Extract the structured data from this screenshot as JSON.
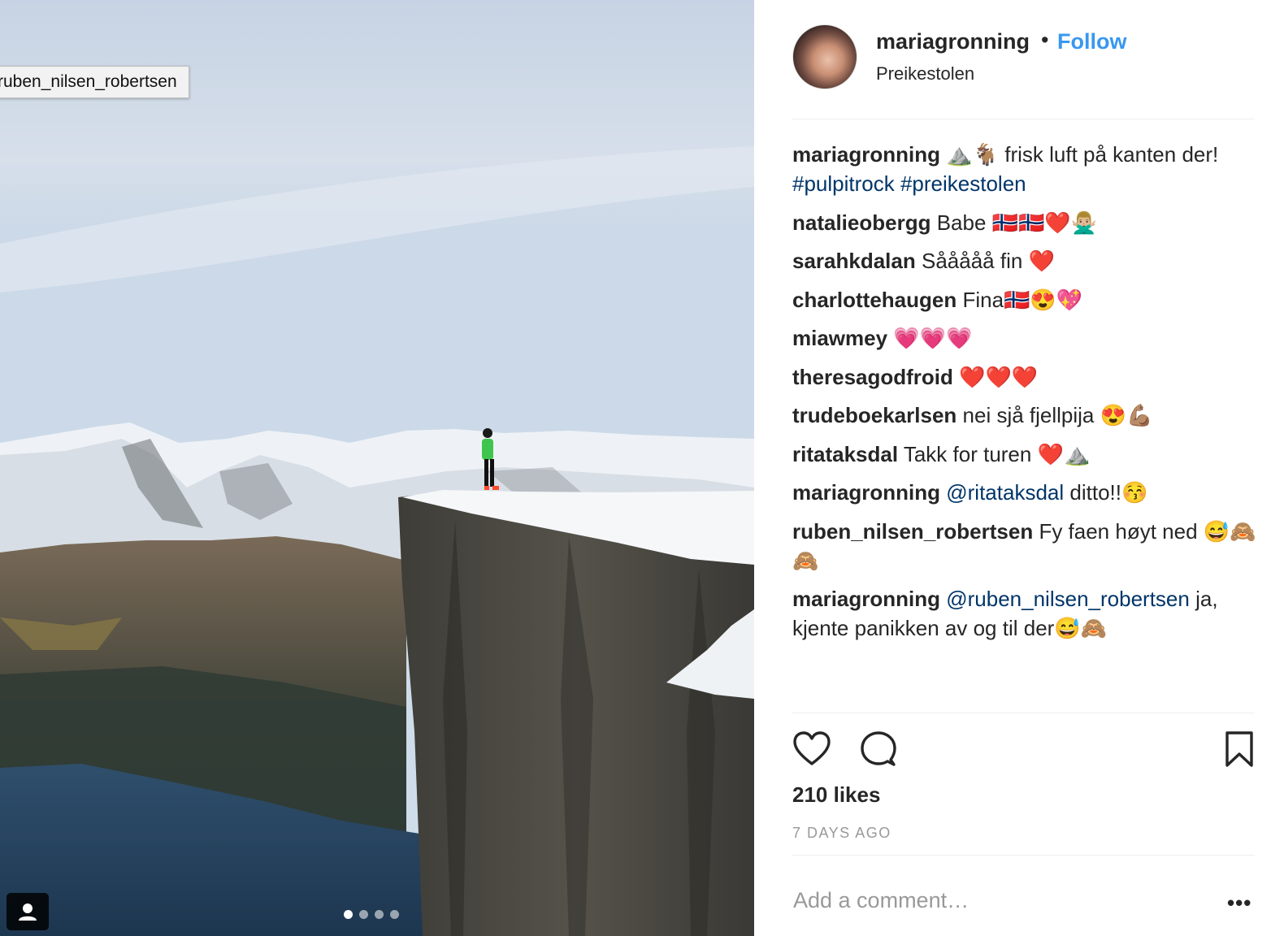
{
  "photo": {
    "tag_tooltip": "ruben_nilsen_robertsen",
    "carousel": {
      "count": 4,
      "active": 1
    }
  },
  "post": {
    "author": "mariagronning",
    "bullet": "•",
    "follow_label": "Follow",
    "location": "Preikestolen",
    "caption": {
      "user": "mariagronning",
      "emojis": "⛰️🐐",
      "text": "frisk luft på kanten der!",
      "hashtags": [
        "#pulpitrock",
        "#preikestolen"
      ]
    },
    "comments": [
      {
        "user": "natalieobergg",
        "text": "Babe 🇳🇴🇳🇴❤️🙅🏼‍♂️"
      },
      {
        "user": "sarahkdalan",
        "text": "Sååååå fin ❤️"
      },
      {
        "user": "charlottehaugen",
        "text": "Fina🇳🇴😍💖"
      },
      {
        "user": "miawmey",
        "text": "💗💗💗"
      },
      {
        "user": "theresagodfroid",
        "text": "❤️❤️❤️"
      },
      {
        "user": "trudeboekarlsen",
        "text": "nei sjå fjellpija 😍💪🏽"
      },
      {
        "user": "ritataksdal",
        "text": "Takk for turen ❤️⛰️"
      },
      {
        "user": "mariagronning",
        "mention": "@ritataksdal",
        "text": "ditto!!😚"
      },
      {
        "user": "ruben_nilsen_robertsen",
        "text": "Fy faen høyt ned 😅🙈🙈"
      },
      {
        "user": "mariagronning",
        "mention": "@ruben_nilsen_robertsen",
        "text": "ja, kjente panikken av og til der😅🙈"
      }
    ],
    "likes": "210 likes",
    "time_ago": "7 DAYS AGO",
    "comment_placeholder": "Add a comment…",
    "more_label": "•••"
  },
  "icons": [
    "heart-icon",
    "comment-icon",
    "bookmark-icon",
    "user-tag-icon"
  ],
  "colors": {
    "follow": "#3897f0",
    "hashtag": "#003569",
    "muted": "#999999",
    "text": "#262626"
  }
}
